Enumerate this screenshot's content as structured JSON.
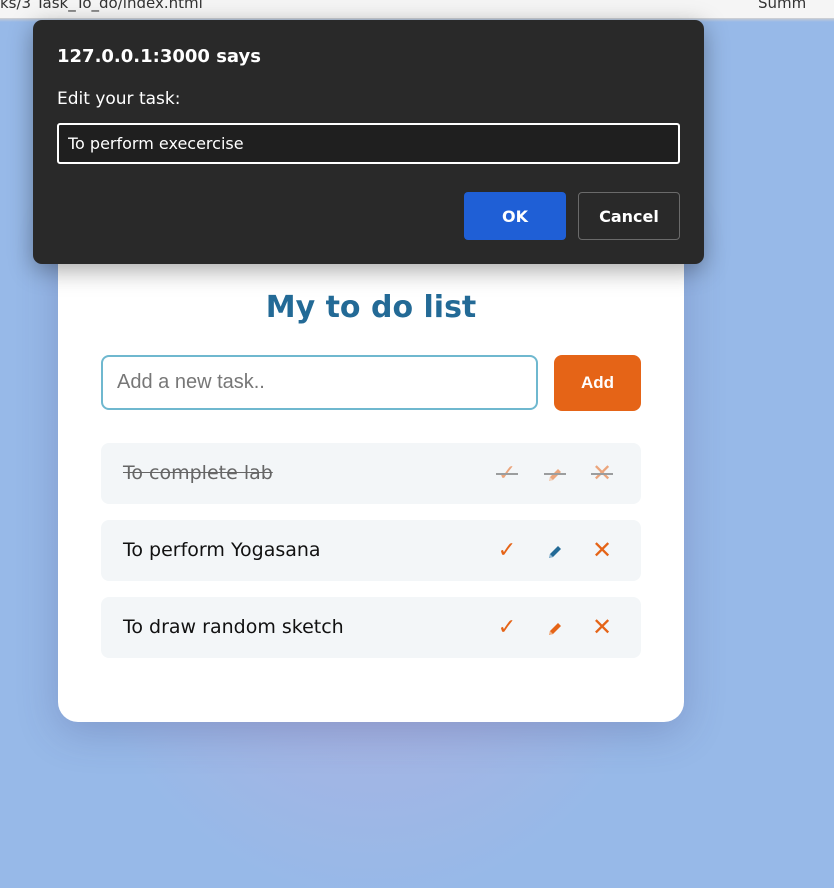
{
  "browser": {
    "url_fragment": "ks/3 Task_To_do/index.html",
    "right_fragment": "Summ"
  },
  "app": {
    "title": "My to do list",
    "new_task_placeholder": "Add a new task..",
    "add_label": "Add",
    "tasks": [
      {
        "label": "To complete lab",
        "completed": true
      },
      {
        "label": "To perform Yogasana",
        "completed": false
      },
      {
        "label": "To draw random sketch",
        "completed": false
      }
    ],
    "icons": {
      "complete": "check-icon",
      "edit": "pencil-icon",
      "delete": "close-icon"
    },
    "colors": {
      "accent": "#e56417",
      "title": "#236a96",
      "edit_icon_active": "#236a96",
      "background": "#97b9e8"
    }
  },
  "dialog": {
    "title": "127.0.0.1:3000 says",
    "message": "Edit your task:",
    "input_value": "To perform execercise",
    "ok_label": "OK",
    "cancel_label": "Cancel"
  }
}
